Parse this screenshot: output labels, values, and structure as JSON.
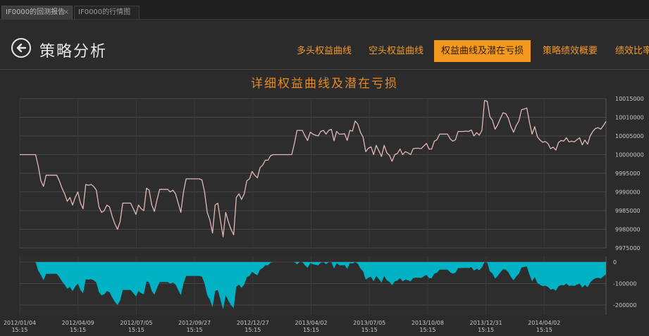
{
  "tabs": [
    {
      "label": "IF0000的回测报告",
      "close": "×"
    },
    {
      "label": "IF0000的行情图"
    }
  ],
  "header": {
    "back_icon": "arrow-left-circle-icon",
    "title": "策略分析"
  },
  "nav": [
    {
      "label": "多头权益曲线"
    },
    {
      "label": "空头权益曲线"
    },
    {
      "label": "权益曲线及潜在亏损",
      "active": true
    },
    {
      "label": "策略绩效概要"
    },
    {
      "label": "绩效比率"
    }
  ],
  "colors": {
    "accent": "#f39a1e",
    "equity_line": "#e2b8b8",
    "drawdown_fill": "#00b2c4"
  },
  "chart_data": {
    "type": "line",
    "title": "详细权益曲线及潜在亏损",
    "x_ticks": [
      {
        "date": "2012/01/04",
        "time": "15:15"
      },
      {
        "date": "2012/04/09",
        "time": "15:15"
      },
      {
        "date": "2012/07/05",
        "time": "15:15"
      },
      {
        "date": "2012/09/27",
        "time": "15:15"
      },
      {
        "date": "2012/12/27",
        "time": "15:15"
      },
      {
        "date": "2013/04/02",
        "time": "15:15"
      },
      {
        "date": "2013/07/05",
        "time": "15:15"
      },
      {
        "date": "2013/10/08",
        "time": "15:15"
      },
      {
        "date": "2013/12/31",
        "time": "15:15"
      },
      {
        "date": "2014/04/02",
        "time": "15:15"
      }
    ],
    "equity": {
      "y_ticks": [
        "10015000",
        "10010000",
        "10005000",
        "10000000",
        "9995000",
        "9990000",
        "9985000",
        "9980000",
        "9975000"
      ],
      "ylim": [
        9975000,
        10015000
      ],
      "series": [
        {
          "values": [
            10000000,
            10000000,
            10000000,
            10000000,
            10000000,
            10000000,
            10000000,
            9997000,
            9993000,
            9991500,
            9994500,
            9994500,
            9994500,
            9994500,
            9994500,
            9993000,
            9991000,
            9989500,
            9987500,
            9988500,
            9986500,
            9988500,
            9990000,
            9987000,
            9985500,
            9992000,
            9991800,
            9992000,
            9991500,
            9990500,
            9986000,
            9984500,
            9985000,
            9986500,
            9986000,
            9983500,
            9981500,
            9980000,
            9982000,
            9987000,
            9987000,
            9987000,
            9987000,
            9985500,
            9984000,
            9986500,
            9985500,
            9985000,
            9991000,
            9990500,
            9986500,
            9984800,
            9988000,
            9990700,
            9990700,
            9990700,
            9990700,
            9990000,
            9990500,
            9989500,
            9987000,
            9984500,
            9990000,
            9993500,
            9993500,
            9993500,
            9993500,
            9993500,
            9993500,
            9993200,
            9990000,
            9984500,
            9982500,
            9979000,
            9986500,
            9987000,
            9982500,
            9978000,
            9984500,
            9982000,
            9980000,
            9978500,
            9988500,
            9989500,
            9988000,
            9989500,
            9993000,
            9993500,
            9995500,
            9994500,
            9993800,
            9996500,
            9997200,
            9998500,
            9998500,
            9999700,
            10000000,
            10000000,
            10000000,
            10000000,
            10000000,
            10000000,
            10000000,
            10000000,
            10003000,
            10006500,
            10006500,
            10006500,
            10005000,
            10003800,
            10006000,
            10005500,
            10005200,
            10005000,
            10006200,
            10006500,
            10005500,
            10006500,
            10006800,
            10003700,
            10006200,
            10005500,
            10005500,
            10005600,
            10003800,
            10006500,
            10006300,
            10009000,
            10008200,
            10006000,
            10004700,
            10000800,
            10001700,
            10002100,
            10000000,
            10002500,
            10001000,
            9999500,
            10002500,
            10000500,
            9999800,
            9998200,
            10000000,
            10000300,
            10001500,
            10000000,
            10000800,
            10000500,
            10000000,
            10001600,
            10001700,
            10001700,
            10001600,
            10002300,
            10003000,
            10001500,
            10001500,
            10003600,
            10004000,
            10005500,
            10005500,
            10005500,
            10005500,
            10004200,
            10003600,
            10004000,
            10006200,
            10006200,
            10006200,
            10006300,
            10006200,
            10006600,
            10005000,
            10005900,
            10005200,
            10006500,
            10014500,
            10014300,
            10010200,
            10009200,
            10006800,
            10008000,
            10009700,
            10011200,
            10011000,
            10009800,
            10007500,
            10006000,
            10007800,
            10009000,
            10012000,
            10012200,
            10012500,
            10008700,
            10005500,
            10007500,
            10004800,
            10003900,
            10003300,
            10003500,
            10003000,
            10001600,
            10002000,
            10001200,
            10003200,
            10003800,
            10003600,
            10004500,
            10003400,
            10003600,
            10003400,
            10004000,
            10004500,
            10002600,
            10003900,
            10002800,
            10005000,
            10006200,
            10007000,
            10007200,
            10006800,
            10007800,
            10008900
          ]
        }
      ]
    },
    "drawdown": {
      "y_ticks": [
        "0",
        "-100000",
        "-200000"
      ],
      "ylim": [
        -230000,
        0
      ],
      "series": [
        {
          "values": [
            0,
            0,
            0,
            0,
            0,
            0,
            0,
            -40000,
            -60000,
            -85000,
            -55000,
            -55000,
            -55000,
            -55000,
            -55000,
            -70000,
            -90000,
            -105000,
            -125000,
            -115000,
            -135000,
            -115000,
            -100000,
            -130000,
            -145000,
            -80000,
            -82000,
            -80000,
            -85000,
            -95000,
            -140000,
            -155000,
            -150000,
            -135000,
            -140000,
            -165000,
            -185000,
            -200000,
            -180000,
            -130000,
            -130000,
            -130000,
            -130000,
            -145000,
            -160000,
            -135000,
            -145000,
            -150000,
            -90000,
            -95000,
            -135000,
            -152000,
            -120000,
            -93000,
            -93000,
            -93000,
            -93000,
            -100000,
            -95000,
            -105000,
            -130000,
            -155000,
            -100000,
            -65000,
            -65000,
            -65000,
            -65000,
            -65000,
            -65000,
            -68000,
            -100000,
            -155000,
            -175000,
            -210000,
            -135000,
            -130000,
            -175000,
            -220000,
            -155000,
            -180000,
            -200000,
            -215000,
            -115000,
            -105000,
            -120000,
            -105000,
            -70000,
            -65000,
            -45000,
            -55000,
            -62000,
            -35000,
            -28000,
            -15000,
            -15000,
            -3000,
            0,
            0,
            0,
            0,
            0,
            0,
            0,
            0,
            0,
            -10000,
            0,
            0,
            -15000,
            -27000,
            -5000,
            -10000,
            -13000,
            -15000,
            -3000,
            0,
            -10000,
            0,
            0,
            -30000,
            -5000,
            -15000,
            -15000,
            -14000,
            -32000,
            -5000,
            -7000,
            0,
            -8000,
            -30000,
            -43000,
            -82000,
            -73000,
            -69000,
            -90000,
            -65000,
            -80000,
            -95000,
            -65000,
            -85000,
            -92000,
            -108000,
            -90000,
            -87000,
            -75000,
            -90000,
            -82000,
            -85000,
            -90000,
            -74000,
            -73000,
            -73000,
            -74000,
            -67000,
            -60000,
            -75000,
            -75000,
            -54000,
            -50000,
            -35000,
            -35000,
            -35000,
            -35000,
            -48000,
            -54000,
            -50000,
            -28000,
            -28000,
            -28000,
            -27000,
            -28000,
            -24000,
            -40000,
            -31000,
            -38000,
            -25000,
            0,
            -2000,
            -43000,
            -53000,
            -77000,
            -65000,
            -48000,
            -33000,
            -35000,
            -47000,
            -70000,
            -85000,
            -67000,
            -55000,
            -25000,
            -23000,
            -20000,
            -58000,
            -90000,
            -70000,
            -97000,
            -106000,
            -112000,
            -110000,
            -115000,
            -129000,
            -125000,
            -133000,
            -113000,
            -107000,
            -109000,
            -100000,
            -111000,
            -109000,
            -111000,
            -105000,
            -100000,
            -119000,
            -106000,
            -117000,
            -95000,
            -83000,
            -75000,
            -73000,
            -77000,
            -67000,
            -56000
          ]
        }
      ]
    },
    "grid": true
  }
}
